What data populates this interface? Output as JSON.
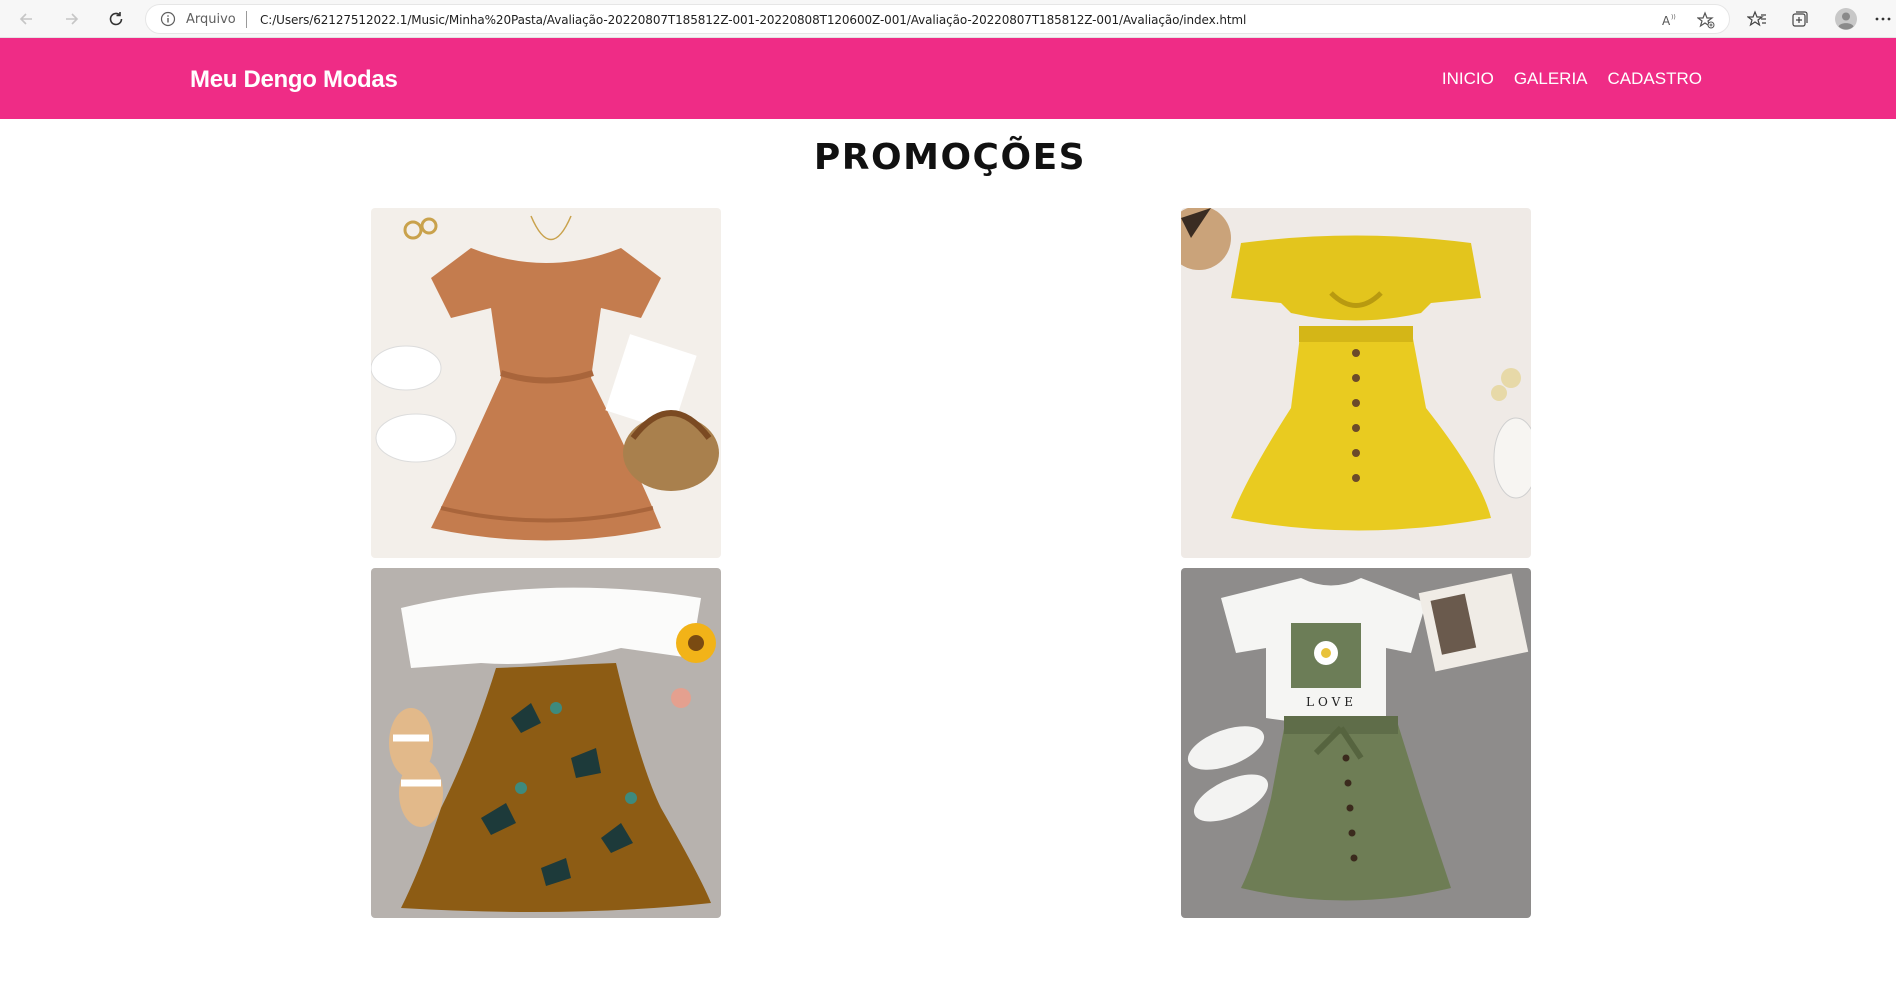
{
  "browser": {
    "scheme_label": "Arquivo",
    "url": "C:/Users/62127512022.1/Music/Minha%20Pasta/Avaliação-20220807T185812Z-001-20220808T120600Z-001/Avaliação-20220807T185812Z-001/Avaliação/index.html",
    "icons": [
      "back-icon",
      "forward-icon",
      "refresh-icon",
      "info-icon",
      "read-aloud-icon",
      "add-favorite-icon",
      "favorites-icon",
      "collections-icon",
      "profile-icon",
      "more-icon"
    ]
  },
  "site": {
    "brand": "Meu Dengo Modas",
    "nav": [
      {
        "label": "INICIO"
      },
      {
        "label": "GALERIA"
      },
      {
        "label": "CADASTRO"
      }
    ],
    "accent_color": "#ef2c86"
  },
  "main": {
    "title": "PROMOÇÕES",
    "products": [
      {
        "image": "caramel-dress-flatlay"
      },
      {
        "image": "yellow-eyelet-set-flatlay"
      },
      {
        "image": "white-top-floral-skirt-flatlay"
      },
      {
        "image": "love-tee-green-skirt-flatlay"
      }
    ]
  }
}
